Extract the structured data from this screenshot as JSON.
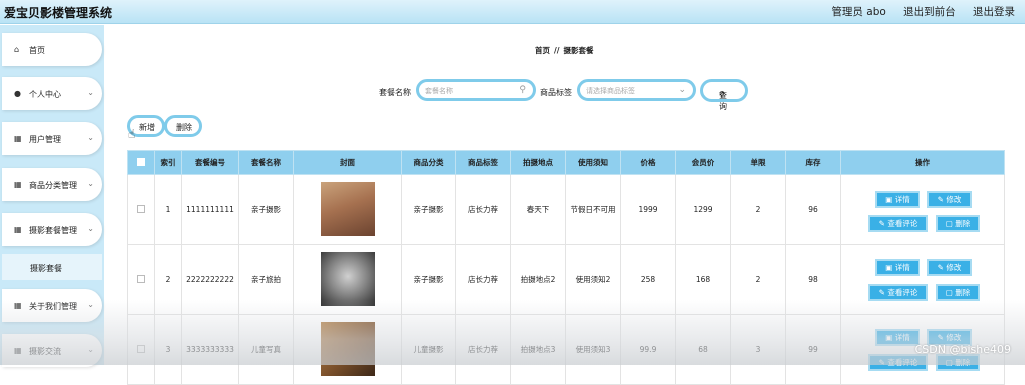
{
  "app": {
    "title": "爱宝贝影楼管理系统"
  },
  "header_links": {
    "admin": "管理员 abo",
    "front": "退出到前台",
    "logout": "退出登录"
  },
  "sidebar": {
    "items": [
      {
        "label": "首页",
        "icon": "home-icon"
      },
      {
        "label": "个人中心",
        "icon": "person-icon"
      },
      {
        "label": "用户管理",
        "icon": "grid-icon"
      },
      {
        "label": "商品分类管理",
        "icon": "grid-icon"
      },
      {
        "label": "摄影套餐管理",
        "icon": "grid-icon"
      },
      {
        "label": "关于我们管理",
        "icon": "grid-icon"
      },
      {
        "label": "摄影交流",
        "icon": "grid-icon"
      }
    ],
    "active_sub": "摄影套餐"
  },
  "breadcrumb": {
    "home": "首页",
    "sep": "//",
    "current": "摄影套餐"
  },
  "search": {
    "name_label": "套餐名称",
    "name_placeholder": "套餐名称",
    "tag_label": "商品标签",
    "tag_placeholder": "请选择商品标签",
    "query_label": "查询"
  },
  "actions": {
    "add_label": "新增",
    "delete_label": "删除"
  },
  "table": {
    "headers": [
      "索引",
      "套餐编号",
      "套餐名称",
      "封面",
      "商品分类",
      "商品标签",
      "拍摄地点",
      "使用须知",
      "价格",
      "会员价",
      "单限",
      "库存",
      "操作"
    ],
    "op_labels": {
      "detail": "详情",
      "edit": "修改",
      "comments": "查看评论",
      "delete": "删除"
    },
    "rows": [
      {
        "index": "1",
        "code": "1111111111",
        "name": "亲子摄影",
        "category": "亲子摄影",
        "tag": "店长力荐",
        "location": "春天下",
        "notes": "节假日不可用",
        "price": "1999",
        "member_price": "1299",
        "limit": "2",
        "stock": "96"
      },
      {
        "index": "2",
        "code": "2222222222",
        "name": "亲子旅拍",
        "category": "亲子摄影",
        "tag": "店长力荐",
        "location": "拍摄地点2",
        "notes": "使用须知2",
        "price": "258",
        "member_price": "168",
        "limit": "2",
        "stock": "98"
      },
      {
        "index": "3",
        "code": "3333333333",
        "name": "儿童写真",
        "category": "儿童摄影",
        "tag": "店长力荐",
        "location": "拍摄地点3",
        "notes": "使用须知3",
        "price": "99.9",
        "member_price": "68",
        "limit": "3",
        "stock": "99"
      }
    ]
  },
  "watermark": "CSDN @bishe409",
  "colors": {
    "accent": "#3ab0e6",
    "header_bg": "#8fcfee",
    "sidebar_bg": "#c9e9f8",
    "pill_border": "#7fcbea"
  }
}
